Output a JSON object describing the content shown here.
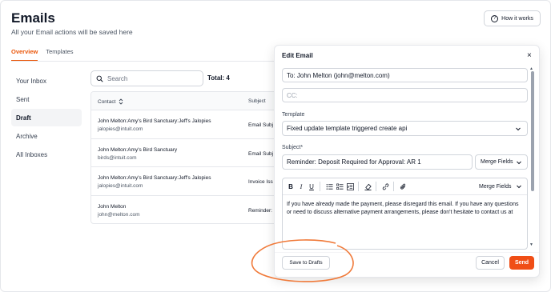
{
  "page": {
    "title": "Emails",
    "subtitle": "All your Email actions will be saved here",
    "how_it_works": "How it works"
  },
  "tabs": [
    {
      "label": "Overview",
      "active": true
    },
    {
      "label": "Templates",
      "active": false
    }
  ],
  "sidebar": {
    "items": [
      {
        "label": "Your Inbox"
      },
      {
        "label": "Sent"
      },
      {
        "label": "Draft"
      },
      {
        "label": "Archive"
      },
      {
        "label": "All Inboxes"
      }
    ]
  },
  "search": {
    "placeholder": "Search",
    "value": ""
  },
  "total": "Total: 4",
  "table": {
    "headers": {
      "contact": "Contact",
      "subject": "Subject"
    },
    "rows": [
      {
        "name": "John Melton:Amy's Bird Sanctuary:Jeff's Jalopies",
        "email": "jalopies@intuit.com",
        "subject": "Email Subj"
      },
      {
        "name": "John Melton:Amy's Bird Sanctuary",
        "email": "birds@intuit.com",
        "subject": "Email Subj"
      },
      {
        "name": "John Melton:Amy's Bird Sanctuary:Jeff's Jalopies",
        "email": "jalopies@intuit.com",
        "subject": "Invoice Iss"
      },
      {
        "name": "John Melton",
        "email": "john@melton.com",
        "subject": "Reminder:"
      }
    ]
  },
  "modal": {
    "title": "Edit Email",
    "close_icon": "×",
    "to_value": "To: John Melton (john@melton.com)",
    "cc_placeholder": "CC:",
    "template_label": "Template",
    "template_value": "Fixed update template triggered create api",
    "subject_label": "Subject*",
    "subject_value": "Reminder: Deposit Required for Approval: AR 1",
    "merge_fields": "Merge Fields",
    "body": "If you have already made the payment, please disregard this email. If you have any questions or need to discuss alternative payment arrangements, please don't hesitate to contact us at",
    "toolbar": {
      "bold": "B",
      "italic": "I",
      "underline": "U"
    },
    "save_to_drafts": "Save to Drafts",
    "cancel": "Cancel",
    "send": "Send"
  },
  "colors": {
    "accent": "#ea580c",
    "send": "#f04e16",
    "annotation": "#f07a3a"
  },
  "icons": [
    "question-icon",
    "search-icon",
    "sort-icon",
    "close-icon",
    "chevron-down-icon",
    "bold-icon",
    "italic-icon",
    "underline-icon",
    "bullet-list-icon",
    "numbered-list-icon",
    "indent-icon",
    "clear-format-icon",
    "link-icon",
    "attachment-icon"
  ]
}
